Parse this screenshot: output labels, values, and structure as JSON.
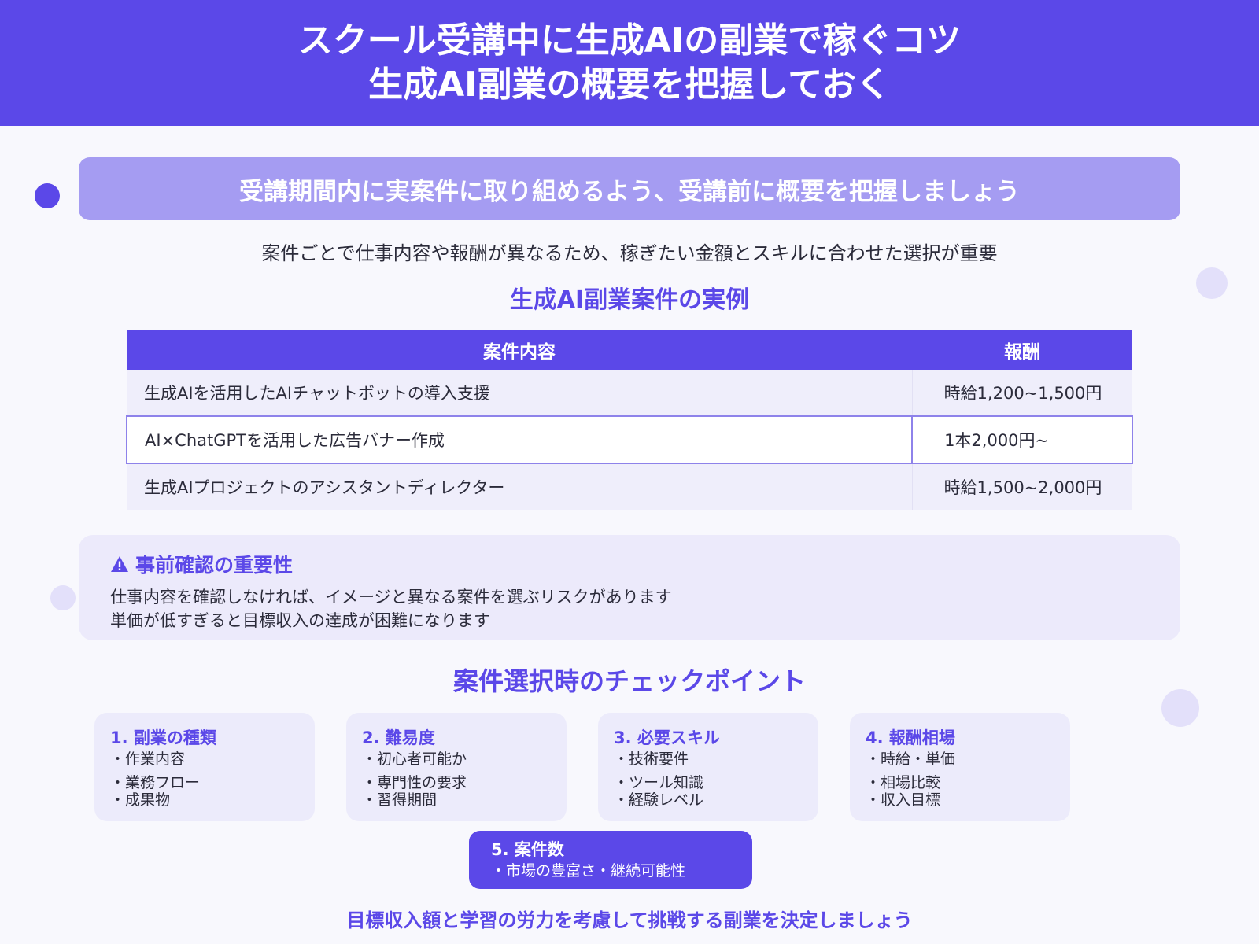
{
  "header": {
    "line1": "スクール受講中に生成AIの副業で稼ぐコツ",
    "line2": "生成AI副業の概要を把握しておく"
  },
  "banner": "受講期間内に実案件に取り組めるよう、受講前に概要を把握しましょう",
  "lead": "案件ごとで仕事内容や報酬が異なるため、稼ぎたい金額とスキルに合わせた選択が重要",
  "examples": {
    "title": "生成AI副業案件の実例",
    "columns": [
      "案件内容",
      "報酬"
    ],
    "rows": [
      {
        "content": "生成AIを活用したAIチャットボットの導入支援",
        "reward": "時給1,200~1,500円"
      },
      {
        "content": "AI×ChatGPTを活用した広告バナー作成",
        "reward": "1本2,000円~"
      },
      {
        "content": "生成AIプロジェクトのアシスタントディレクター",
        "reward": "時給1,500~2,000円"
      }
    ]
  },
  "warning": {
    "icon": "warning-icon",
    "title": "事前確認の重要性",
    "lines": [
      "仕事内容を確認しなければ、イメージと異なる案件を選ぶリスクがあります",
      "単価が低すぎると目標収入の達成が困難になります"
    ]
  },
  "checkpoints": {
    "title": "案件選択時のチェックポイント",
    "cards": [
      {
        "title": "1. 副業の種類",
        "items": [
          "・作業内容",
          "・業務フロー",
          "・成果物"
        ]
      },
      {
        "title": "2. 難易度",
        "items": [
          "・初心者可能か",
          "・専門性の要求",
          "・習得期間"
        ]
      },
      {
        "title": "3. 必要スキル",
        "items": [
          "・技術要件",
          "・ツール知識",
          "・経験レベル"
        ]
      },
      {
        "title": "4. 報酬相場",
        "items": [
          "・時給・単価",
          "・相場比較",
          "・収入目標"
        ]
      },
      {
        "title": "5. 案件数",
        "items": [
          "・市場の豊富さ・継続可能性"
        ]
      }
    ]
  },
  "footer": "目標収入額と学習の労力を考慮して挑戦する副業を決定しましょう",
  "colors": {
    "primary": "#5b48e8",
    "banner": "#a59cf2",
    "card_bg": "#ecebfb",
    "background": "#f8f8fd"
  }
}
